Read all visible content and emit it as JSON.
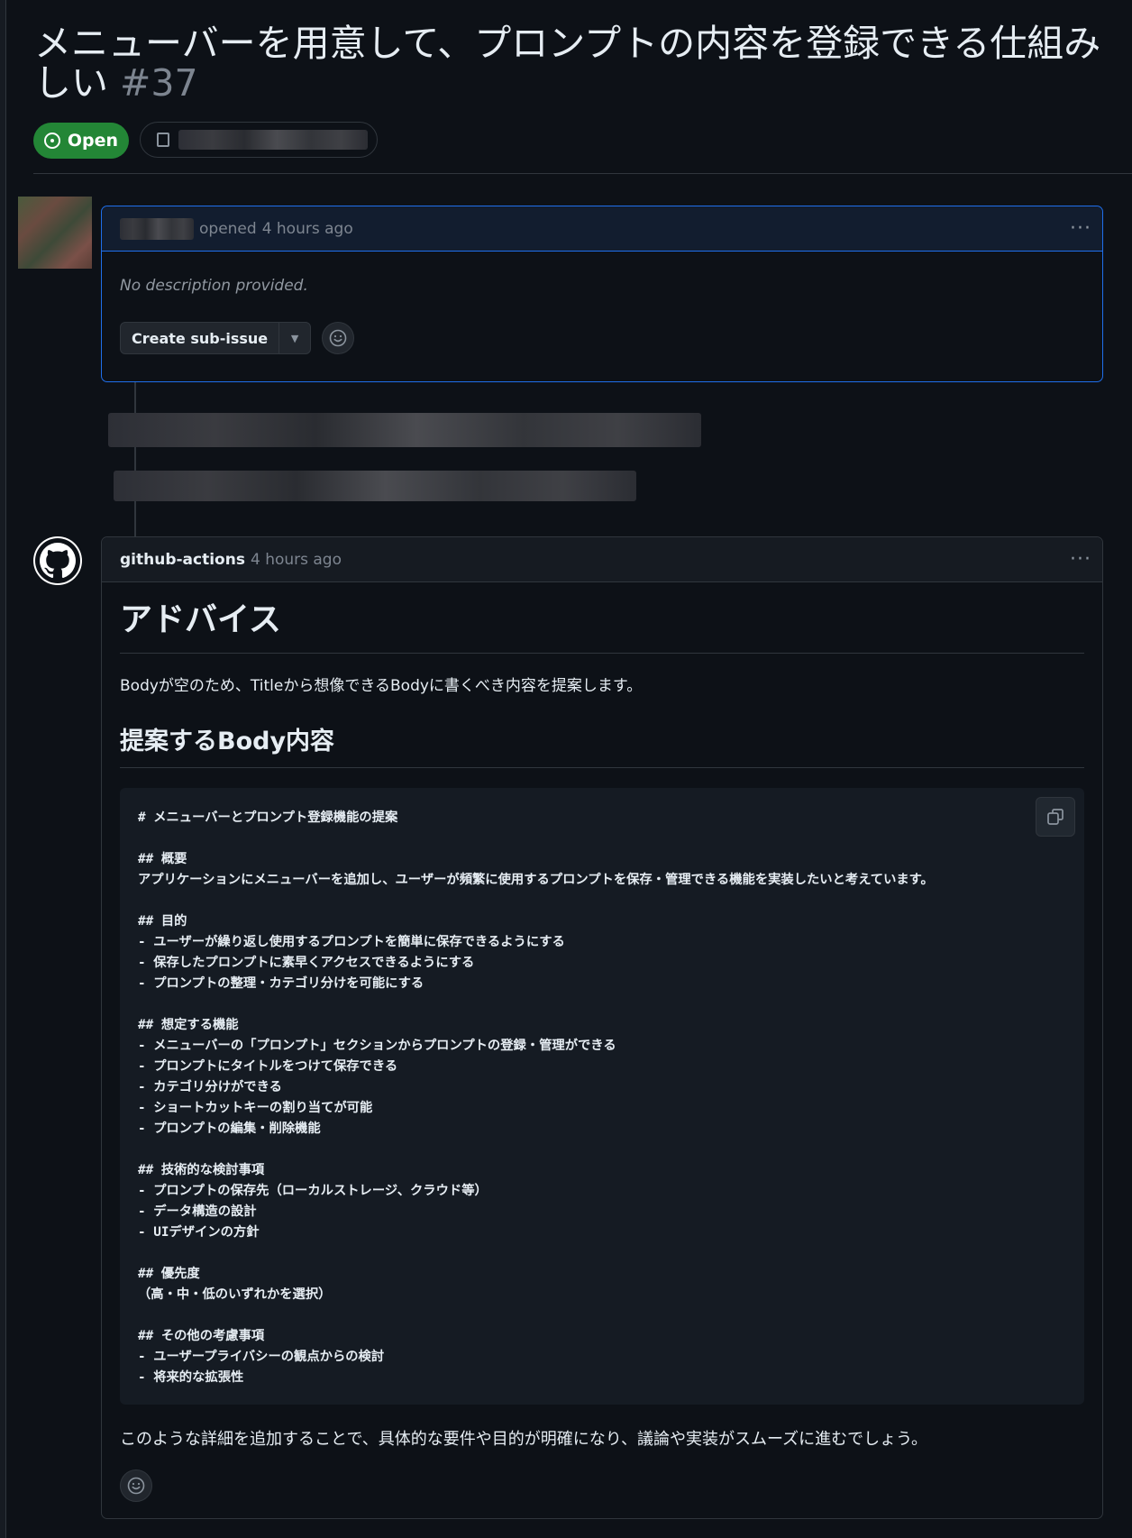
{
  "issue": {
    "title_line1": "メニューバーを用意して、プロンプトの内容を登録できる仕組み",
    "title_line2": "しい",
    "number": "#37",
    "state": "Open"
  },
  "opening_comment": {
    "action": "opened",
    "time": "4 hours ago",
    "body": "No description provided.",
    "create_sub_issue_label": "Create sub-issue",
    "menu_label": "···"
  },
  "bot_comment": {
    "author": "github-actions",
    "time": "4 hours ago",
    "menu_label": "···",
    "heading": "アドバイス",
    "intro": "Bodyが空のため、Titleから想像できるBodyに書くべき内容を提案します。",
    "subheading": "提案するBody内容",
    "code_lines": [
      "# メニューバーとプロンプト登録機能の提案",
      "",
      "## 概要",
      "アプリケーションにメニューバーを追加し、ユーザーが頻繁に使用するプロンプトを保存・管理できる機能を実装したいと考えています。",
      "",
      "## 目的",
      "- ユーザーが繰り返し使用するプロンプトを簡単に保存できるようにする",
      "- 保存したプロンプトに素早くアクセスできるようにする",
      "- プロンプトの整理・カテゴリ分けを可能にする",
      "",
      "## 想定する機能",
      "- メニューバーの「プロンプト」セクションからプロンプトの登録・管理ができる",
      "- プロンプトにタイトルをつけて保存できる",
      "- カテゴリ分けができる",
      "- ショートカットキーの割り当てが可能",
      "- プロンプトの編集・削除機能",
      "",
      "## 技術的な検討事項",
      "- プロンプトの保存先（ローカルストレージ、クラウド等）",
      "- データ構造の設計",
      "- UIデザインの方針",
      "",
      "## 優先度",
      "（高・中・低のいずれかを選択）",
      "",
      "## その他の考慮事項",
      "- ユーザープライバシーの観点からの検討",
      "- 将来的な拡張性"
    ],
    "closing": "このような詳細を追加することで、具体的な要件や目的が明確になり、議論や実装がスムーズに進むでしょう。"
  },
  "colors": {
    "background": "#0d1117",
    "open_badge": "#238636",
    "accent_border": "#1f6feb",
    "muted_text": "#7d8590"
  },
  "icons": {
    "state": "issue-open-icon",
    "repo": "repo-icon",
    "emoji": "smiley-icon",
    "copy": "copy-icon",
    "bot_avatar": "github-mark-icon"
  }
}
